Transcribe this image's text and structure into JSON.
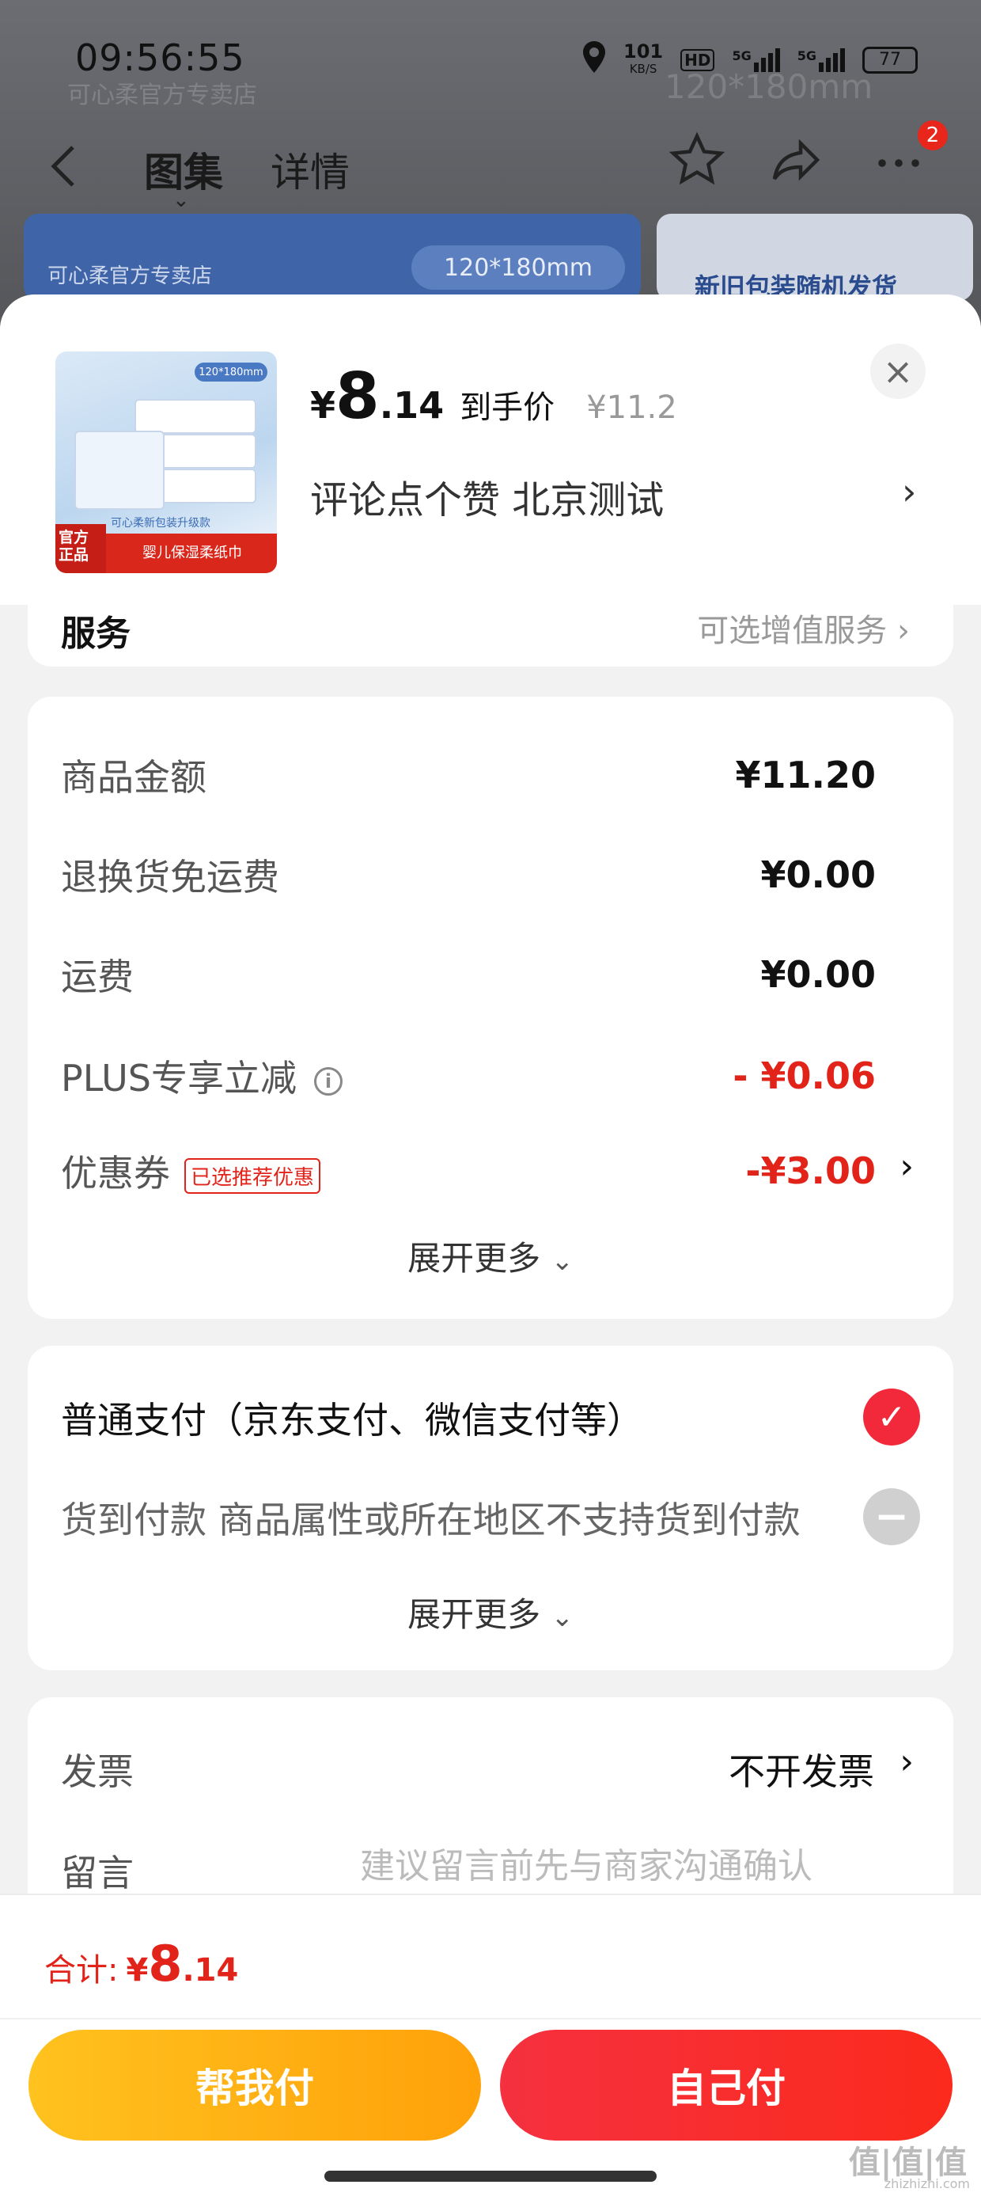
{
  "status_bar": {
    "time": "09:56:55",
    "network_speed": "101",
    "network_unit": "KB/S",
    "hd_badge": "HD",
    "signal1": "5G",
    "signal2": "5G",
    "battery": "77",
    "icons": [
      "location-icon",
      "signal-icon",
      "battery-icon"
    ]
  },
  "background": {
    "watermark": "可心柔官方专卖店",
    "size_watermark": "120*180mm",
    "gallery_store": "可心柔官方专卖店",
    "gallery_size": "120*180mm",
    "gallery2_text": "新旧包装随机发货"
  },
  "nav": {
    "tab_gallery": "图集",
    "tab_detail": "详情",
    "badge_count": "2",
    "icons": [
      "back-icon",
      "star-icon",
      "share-icon",
      "more-icon"
    ]
  },
  "product": {
    "currency": "¥",
    "price_int": "8",
    "price_dec": ".14",
    "price_label": "到手价",
    "original_price": "¥11.2",
    "spec": "评论点个赞  北京测试",
    "thumb_size": "120*180mm",
    "thumb_tag_official": "官方正品",
    "thumb_tag_text": "婴儿保湿柔纸巾",
    "thumb_upgrade": "可心柔新包装升级款"
  },
  "service": {
    "label": "服务",
    "value": "可选增值服务"
  },
  "price_breakdown": {
    "rows": [
      {
        "label": "商品金额",
        "value": "¥11.20"
      },
      {
        "label": "退换货免运费",
        "value": "¥0.00"
      },
      {
        "label": "运费",
        "value": "¥0.00"
      },
      {
        "label": "PLUS专享立减",
        "value": "- ¥0.06"
      },
      {
        "label": "优惠券",
        "value": "-¥3.00",
        "tag": "已选推荐优惠"
      }
    ],
    "expand_more": "展开更多"
  },
  "payment": {
    "option1": "普通支付（京东支付、微信支付等）",
    "option2": "货到付款 商品属性或所在地区不支持货到付款",
    "expand_more": "展开更多"
  },
  "invoice": {
    "label": "发票",
    "value": "不开发票"
  },
  "note": {
    "label": "留言",
    "placeholder": "建议留言前先与商家沟通确认"
  },
  "footer": {
    "total_label": "合计:",
    "total_currency": "¥",
    "total_int": "8",
    "total_dec": ".14",
    "btn_help": "帮我付",
    "btn_self": "自己付",
    "watermark": "值|值|值",
    "watermark_url": "zhizhizhi.com"
  },
  "colors": {
    "accent_red": "#e2231a",
    "help_button": "#ffb216",
    "self_button": "#f52b2e"
  }
}
